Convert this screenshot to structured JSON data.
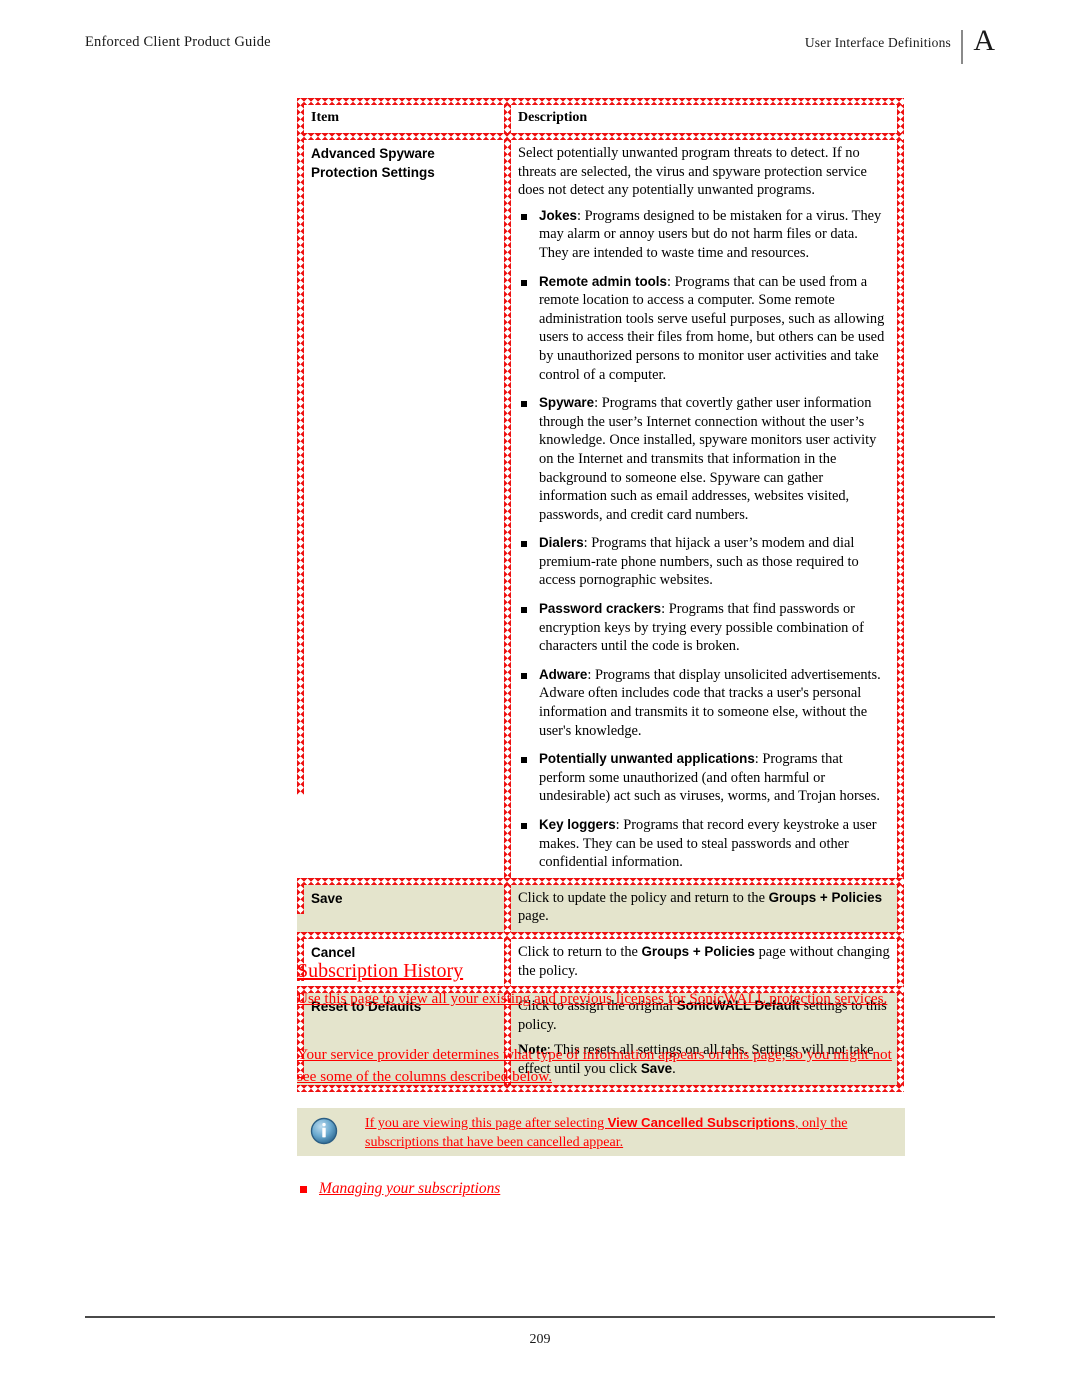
{
  "header": {
    "left_title": "Enforced Client Product Guide",
    "right_title": "User Interface Definitions",
    "appendix_letter": "A"
  },
  "footer": {
    "page_number": "209"
  },
  "table": {
    "columns": [
      "Item",
      "Description"
    ],
    "rows": [
      {
        "item": "Advanced Spyware Protection Settings",
        "intro": "Select potentially unwanted program threats to detect. If no threats are selected, the virus and spyware protection service does not detect any potentially unwanted programs.",
        "bullets": [
          {
            "term": "Jokes",
            "text": ": Programs designed to be mistaken for a virus. They may alarm or annoy users but do not harm files or data. They are intended to waste time and resources."
          },
          {
            "term": "Remote admin tools",
            "text": ": Programs that can be used from a remote location to access a computer. Some remote administration tools serve useful purposes, such as allowing users to access their files from home, but others can be used by unauthorized persons to monitor user activities and take control of a computer."
          },
          {
            "term": "Spyware",
            "text": ": Programs that covertly gather user information through the user’s Internet connection without the user’s knowledge. Once installed, spyware monitors user activity on the Internet and transmits that information in the background to someone else. Spyware can gather information such as email addresses, websites visited, passwords, and credit card numbers."
          },
          {
            "term": "Dialers",
            "text": ": Programs that hijack a user’s modem and dial premium-rate phone numbers, such as those required to access pornographic websites."
          },
          {
            "term": "Password crackers",
            "text": ": Programs that find passwords or encryption keys by trying every possible combination of characters until the code is broken."
          },
          {
            "term": "Adware",
            "text": ": Programs that display unsolicited advertisements. Adware often includes code that tracks a user's personal information and transmits it to someone else, without the user's knowledge."
          },
          {
            "term": "Potentially unwanted applications",
            "text": ": Programs that perform some unauthorized (and often harmful or undesirable) act such as viruses, worms, and Trojan horses."
          },
          {
            "term": "Key loggers",
            "text": ": Programs that record every keystroke a user makes. They can be used to steal passwords and other confidential information."
          }
        ]
      }
    ],
    "action_rows": [
      {
        "item": "Save",
        "desc_prefix": "Click to update the policy and return to the ",
        "desc_term": "Groups + Policies",
        "desc_suffix": " page.",
        "shade": "beige"
      },
      {
        "item": "Cancel",
        "desc_prefix": "Click to return to the ",
        "desc_term": "Groups + Policies",
        "desc_suffix": " page without changing the policy.",
        "shade": "white"
      },
      {
        "item": "Reset to Defaults",
        "desc_prefix": "Click to assign the original ",
        "desc_term": "SonicWALL Default",
        "desc_suffix": " settings to this policy.",
        "note_label": "Note",
        "note_prefix": ": This resets all settings on all tabs. Settings will not take effect until you click ",
        "note_term": "Save",
        "note_suffix": ".",
        "shade": "beige"
      }
    ]
  },
  "section": {
    "heading": "Subscription History ",
    "paragraph_1": "Use this page to view all your existing and previous licenses for SonicWALL protection services. ",
    "paragraph_2": "Your service provider determines what type of information appears on this page, so you might not see some of the columns described below. "
  },
  "note_box": {
    "icon": "info-icon",
    "prefix": "If you are viewing this page after selecting ",
    "term": "View Cancelled Subscriptions",
    "suffix": ", only the subscriptions that have been cancelled appear. "
  },
  "link_item": {
    "label": "Managing your subscriptions"
  },
  "colors": {
    "revision_red": "#ff0000",
    "table_shade_beige": "#e4e4cc",
    "hatch_red": "#ee1111",
    "info_icon_blue": "#4f93c0"
  }
}
